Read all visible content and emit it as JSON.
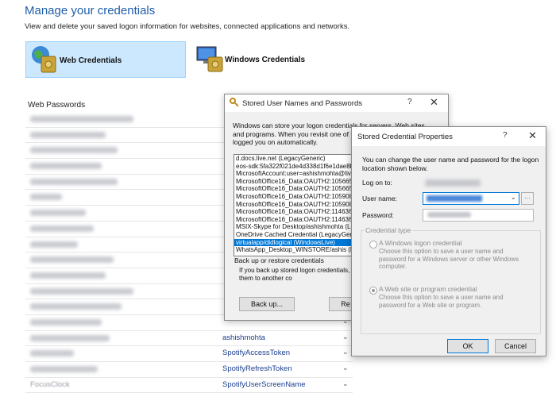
{
  "credential_manager": {
    "title": "Manage your credentials",
    "subtitle": "View and delete your saved logon information for websites, connected applications and networks.",
    "tabs": [
      {
        "label": "Web Credentials",
        "icon": "web-credentials-icon",
        "selected": true
      },
      {
        "label": "Windows Credentials",
        "icon": "windows-credentials-icon",
        "selected": false
      }
    ],
    "web_passwords_header": "Web Passwords",
    "rows": [
      {
        "account": ""
      },
      {
        "account": ""
      },
      {
        "account": ""
      },
      {
        "account": ""
      },
      {
        "account": ""
      },
      {
        "account": ""
      },
      {
        "account": ""
      },
      {
        "account": ""
      },
      {
        "account": ""
      },
      {
        "account": ""
      },
      {
        "account": ""
      },
      {
        "account": ""
      },
      {
        "account": ""
      },
      {
        "account": ""
      },
      {
        "account": "ashishmohta"
      },
      {
        "account": "SpotifyAccessToken"
      },
      {
        "account": "SpotifyRefreshToken"
      },
      {
        "account": "SpotifyUserScreenName"
      }
    ],
    "last_row_site": "FocusClock"
  },
  "stored_dialog": {
    "title": "Stored User Names and Passwords",
    "help": "?",
    "close": "✕",
    "intro": "Windows can store your logon credentials for servers, Web sites, and programs. When you revisit one of those locations, you are logged you on automatically.",
    "credentials": [
      "d.docs.live.net (LegacyGeneric)",
      "eos-sdk:5fa322f021de4d338d1f6e1dae8b",
      "MicrosoftAccount:user=ashishmohta@live.",
      "MicrosoftOffice16_Data:OAUTH2:1056659",
      "MicrosoftOffice16_Data:OAUTH2:1056659",
      "MicrosoftOffice16_Data:OAUTH2:1059083",
      "MicrosoftOffice16_Data:OAUTH2:1059083",
      "MicrosoftOffice16_Data:OAUTH2:1146368",
      "MicrosoftOffice16_Data:OAUTH2:1146368",
      "MSIX-Skype for Desktop/ashishmohta (Leg",
      "OneDrive Cached Credential (LegacyGene",
      "virtualapp/didlogical (WindowsLive)",
      "WhatsApp_Desktop_WINSTORE/ashis (L"
    ],
    "selected_index": 11,
    "backup_header": "Back up or restore credentials",
    "backup_text": "If you back up stored logon credentials, yo restore them or transfer them to another co",
    "backup_button": "Back up...",
    "restore_button": "Re"
  },
  "props_dialog": {
    "title": "Stored Credential Properties",
    "help": "?",
    "close": "✕",
    "intro": "You can change the user name and password for the logon location shown below.",
    "log_on_to_label": "Log on to:",
    "user_name_label": "User name:",
    "password_label": "Password:",
    "credential_type_label": "Credential type",
    "windows_logon_label": "A Windows logon credential",
    "windows_logon_desc": "Choose this option to save a user name and password for a Windows server or other Windows computer.",
    "web_credential_label": "A Web site or program credential",
    "web_credential_desc": "Choose this option to save a user name and password for a Web site or program.",
    "selected_type": "web",
    "ok_button": "OK",
    "cancel_button": "Cancel"
  }
}
